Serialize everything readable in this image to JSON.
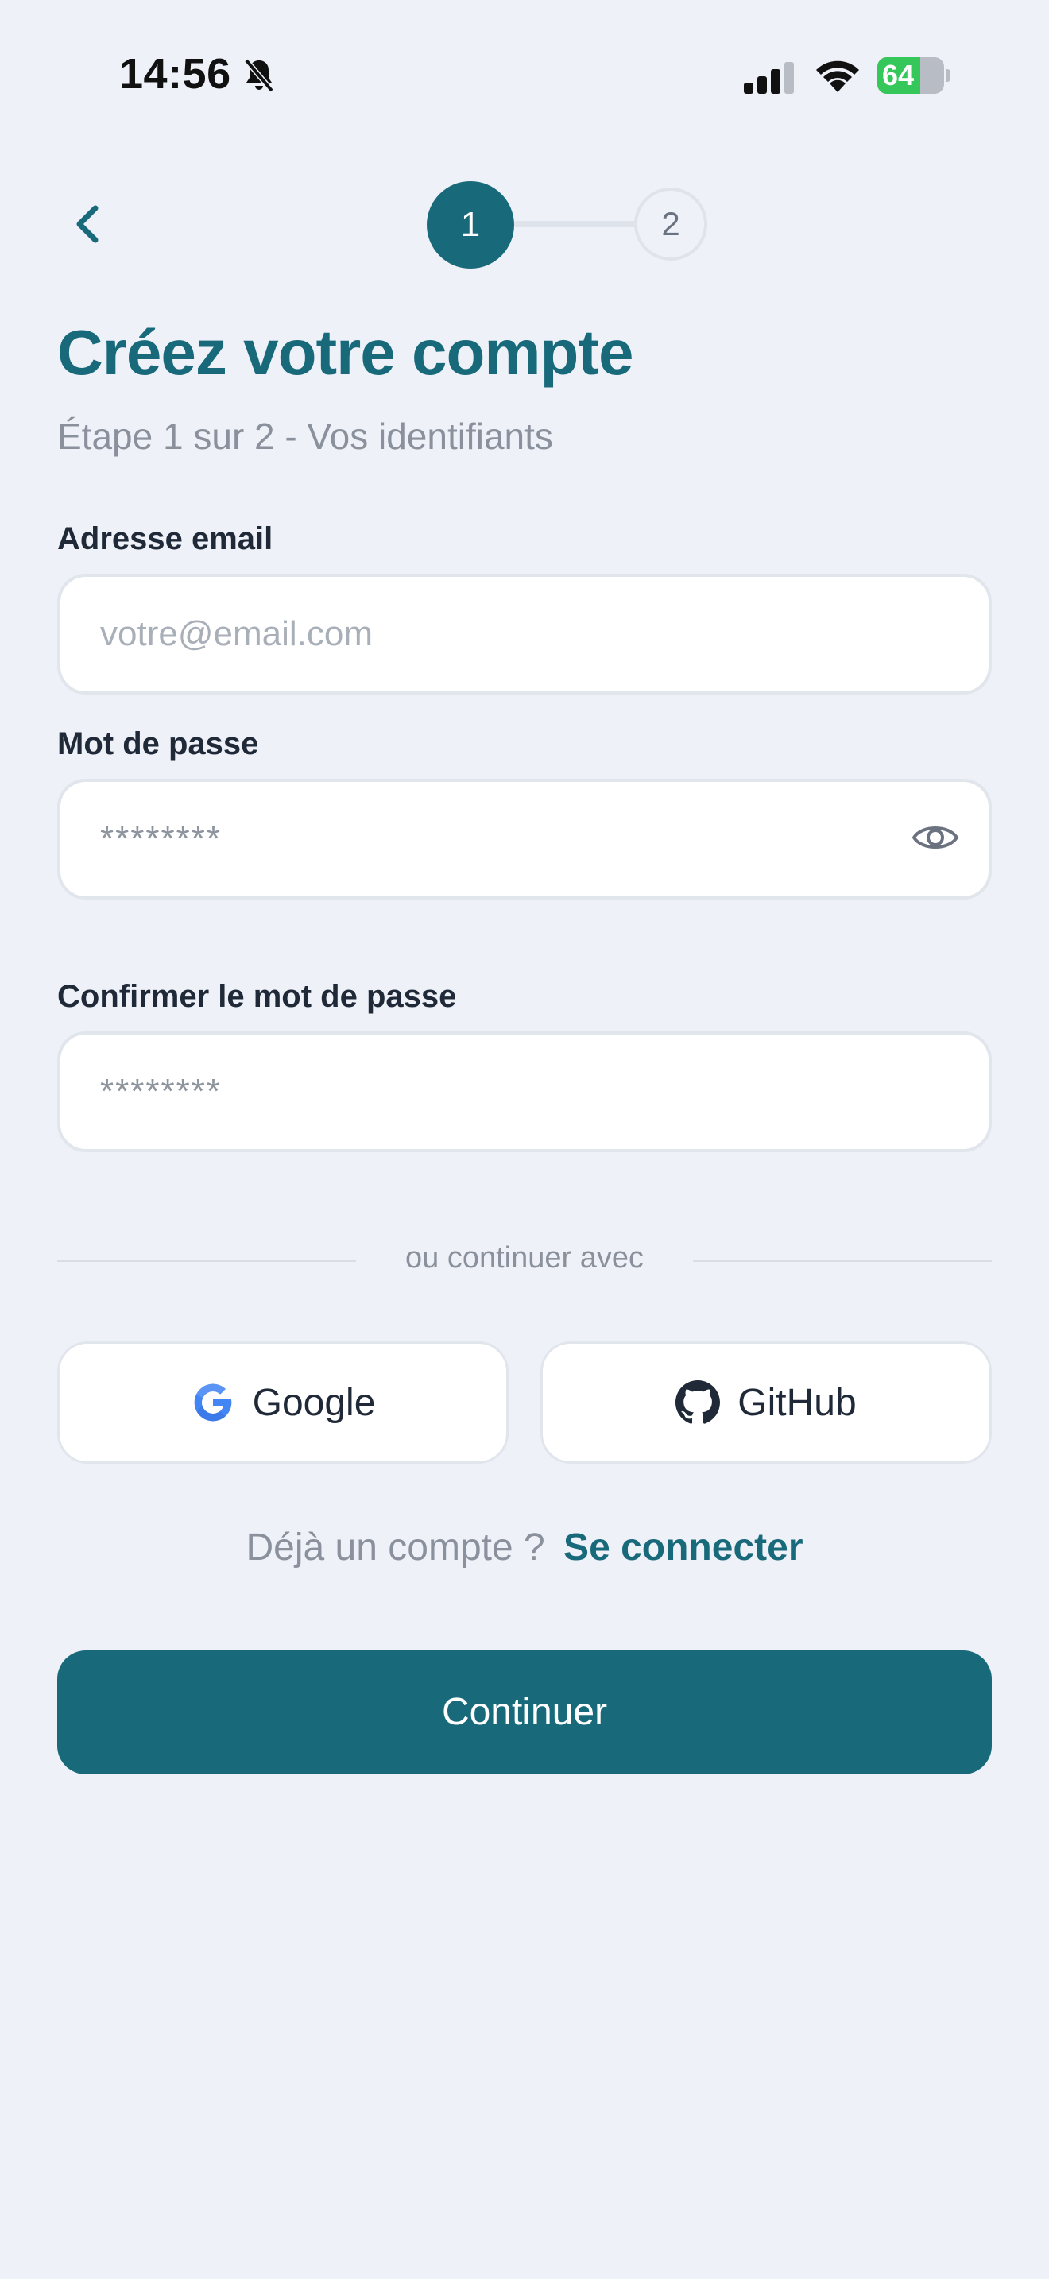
{
  "status_bar": {
    "time": "14:56",
    "battery_percent": 64,
    "battery_label": "64"
  },
  "stepper": {
    "step1": "1",
    "step2": "2",
    "active_color": "#186a7b"
  },
  "header": {
    "title": "Créez votre compte",
    "subtitle": "Étape 1 sur 2 - Vos identifiants"
  },
  "form": {
    "email_label": "Adresse email",
    "email_placeholder": "votre@email.com",
    "password_label": "Mot de passe",
    "password_placeholder": "********",
    "confirm_label": "Confirmer le mot de passe",
    "confirm_placeholder": "********"
  },
  "divider_text": "ou continuer avec",
  "social": {
    "google_label": "Google",
    "github_label": "GitHub"
  },
  "signin": {
    "question": "Déjà un compte ?",
    "link": "Se connecter"
  },
  "cta_label": "Continuer",
  "icons": [
    "bell-slash-icon",
    "signal-icon",
    "wifi-icon",
    "battery-icon",
    "chevron-left-icon",
    "eye-icon",
    "google-icon",
    "github-icon"
  ]
}
